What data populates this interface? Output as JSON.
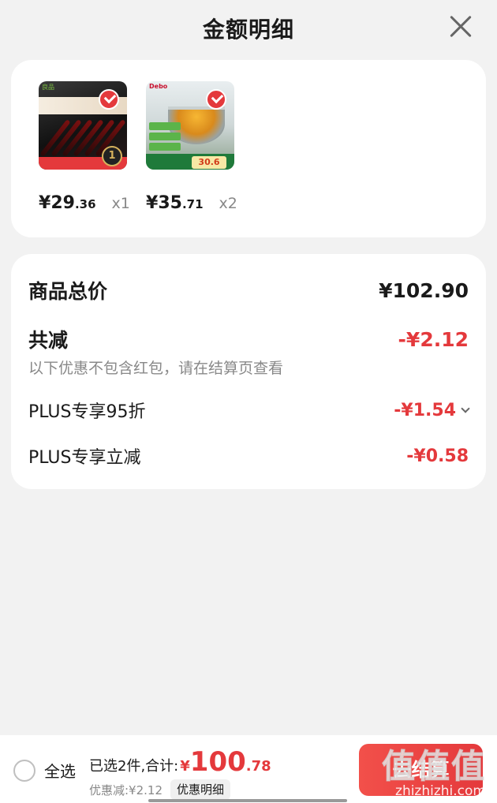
{
  "header": {
    "title": "金额明细",
    "close_icon": "close-icon"
  },
  "products": [
    {
      "thumb_logo": "良品",
      "price_symbol": "¥",
      "price_int": "29",
      "price_dec": ".36",
      "qty": "x1",
      "selected": true
    },
    {
      "thumb_logo": "Debo",
      "thumb_price": "30.6",
      "price_symbol": "¥",
      "price_int": "35",
      "price_dec": ".71",
      "qty": "x2",
      "selected": true
    }
  ],
  "summary": {
    "total_label": "商品总价",
    "total_value": "¥102.90",
    "reduce_label": "共减",
    "reduce_value": "-¥2.12",
    "note": "以下优惠不包含红包，请在结算页查看",
    "discounts": [
      {
        "label": "PLUS专享95折",
        "value": "-¥1.54",
        "icon": "chevron-down-icon"
      },
      {
        "label": "PLUS专享立减",
        "value": "-¥0.58"
      }
    ]
  },
  "bottom_bar": {
    "select_all": "全选",
    "selected_text": "已选2件,合计:",
    "sum_symbol": "¥",
    "sum_int": "100",
    "sum_dec": ".78",
    "discount_text": "优惠减:¥2.12",
    "detail_button": "优惠明细",
    "checkout_button": "去结算"
  },
  "watermark": {
    "big": "值值值",
    "small": "zhizhizhi.com"
  },
  "colors": {
    "accent": "#e4393c",
    "background": "#f2f2f2",
    "card": "#ffffff"
  }
}
